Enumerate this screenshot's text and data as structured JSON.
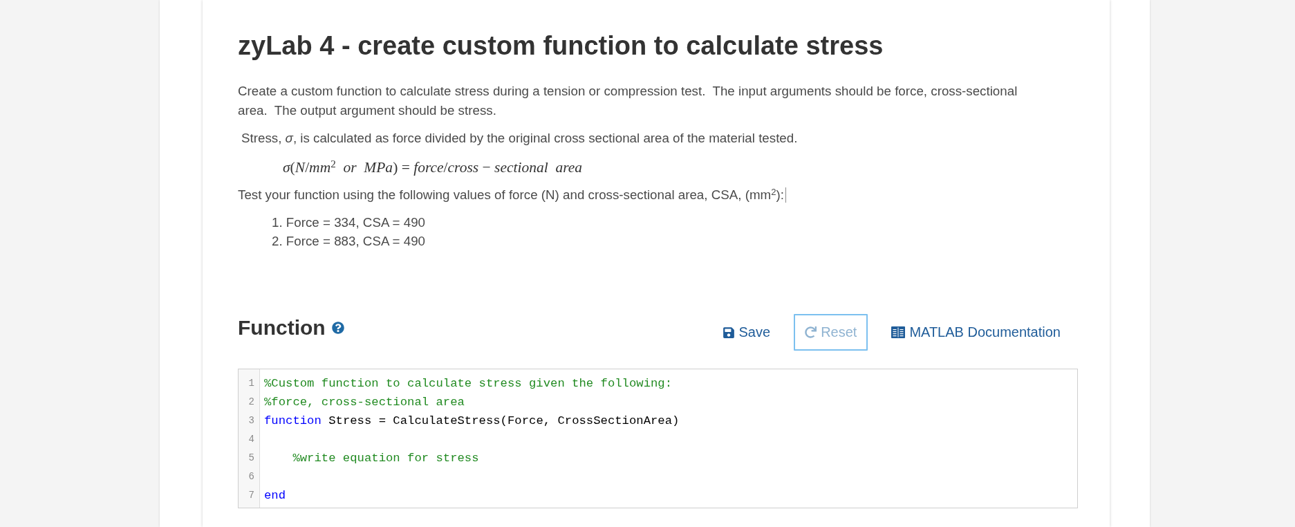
{
  "page": {
    "title": "zyLab 4 - create custom function to calculate stress"
  },
  "instructions": {
    "description": "Create a custom function to calculate stress during a tension or compression test.  The input arguments should be force, cross-sectional area.  The output argument should be stress.",
    "definition": "Stress, *σ*, is calculated as force divided by the original cross sectional area of the material tested.",
    "formula": "*σ*(*N*/*mm*$^{2}$  *or*  *MPa*) = *force*/*cross* − *sectional*  *area*",
    "test_prompt": "Test your function using the following values of force (N) and cross-sectional area, CSA, (mm$^{2}$):",
    "text_cursor": true,
    "test_values": [
      {
        "number": "1.",
        "text": "Force = 334, CSA = 490"
      },
      {
        "number": "2.",
        "text": "Force = 883, CSA = 490"
      }
    ]
  },
  "function_section": {
    "heading": "Function",
    "buttons": [
      {
        "kind": "save",
        "label": "Save",
        "disabled": false,
        "focused": false
      },
      {
        "kind": "reset",
        "label": "Reset",
        "disabled": true,
        "focused": true
      },
      {
        "kind": "documentation",
        "label": "MATLAB Documentation",
        "disabled": false,
        "focused": false
      }
    ]
  },
  "editor": {
    "lines": [
      {
        "number": "1",
        "tokens": [
          {
            "kind": "comment",
            "text": "%Custom function to calculate stress given the following:"
          }
        ]
      },
      {
        "number": "2",
        "tokens": [
          {
            "kind": "comment",
            "text": "%force, cross-sectional area"
          }
        ]
      },
      {
        "number": "3",
        "tokens": [
          {
            "kind": "keyword",
            "text": "function"
          },
          {
            "kind": "plain",
            "text": " Stress = CalculateStress(Force, CrossSectionArea)"
          }
        ]
      },
      {
        "number": "4"
      },
      {
        "number": "5",
        "tokens": [
          {
            "kind": "comment",
            "text": "    %write equation for stress"
          }
        ]
      },
      {
        "number": "6"
      },
      {
        "number": "7",
        "tokens": [
          {
            "kind": "keyword",
            "text": "end"
          }
        ]
      }
    ]
  }
}
